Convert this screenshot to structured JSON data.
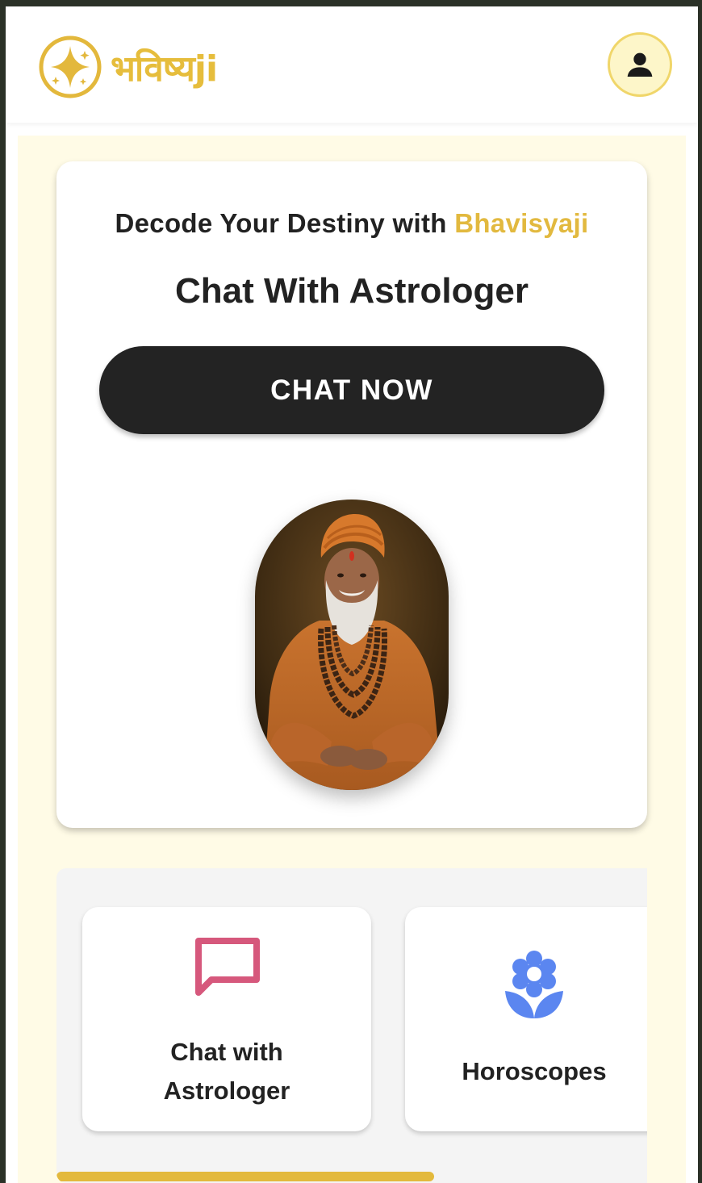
{
  "header": {
    "logo_text": "भविष्यji",
    "logo_icon": "sparkle-star-icon",
    "profile_icon": "user-icon"
  },
  "hero": {
    "tagline_prefix": "Decode Your Destiny with ",
    "tagline_brand": "Bhavisyaji",
    "title": "Chat With Astrologer",
    "cta_label": "CHAT NOW",
    "image": "astrologer-portrait"
  },
  "services": {
    "items": [
      {
        "label_line1": "Chat with",
        "label_line2": "Astrologer",
        "icon": "chat-bubble-icon",
        "icon_color": "#d6587c"
      },
      {
        "label": "Horoscopes",
        "icon": "flower-icon",
        "icon_color": "#5b86f0"
      }
    ]
  },
  "colors": {
    "brand": "#e2b93f",
    "cream_bg": "#fffbe6",
    "cta_bg": "#232323"
  }
}
